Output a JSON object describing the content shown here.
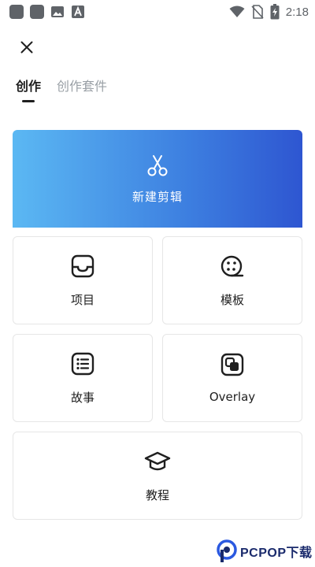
{
  "status_bar": {
    "time": "2:18",
    "icons": [
      "app-icon",
      "app-icon",
      "image-icon",
      "font-icon",
      "wifi-icon",
      "no-sim-icon",
      "battery-charging-icon"
    ]
  },
  "header": {
    "close_icon": "close-icon"
  },
  "tabs": [
    {
      "label": "创作",
      "active": true
    },
    {
      "label": "创作套件",
      "active": false
    }
  ],
  "new_edit": {
    "label": "新建剪辑",
    "icon": "scissors-icon",
    "gradient": [
      "#5bb8f3",
      "#2e56d1"
    ]
  },
  "cards": [
    {
      "label": "项目",
      "icon": "inbox-icon"
    },
    {
      "label": "模板",
      "icon": "film-reel-icon"
    },
    {
      "label": "故事",
      "icon": "list-icon"
    },
    {
      "label": "Overlay",
      "icon": "overlay-icon"
    },
    {
      "label": "教程",
      "icon": "graduation-cap-icon"
    }
  ],
  "watermark": {
    "text": "PCPOP下载"
  }
}
